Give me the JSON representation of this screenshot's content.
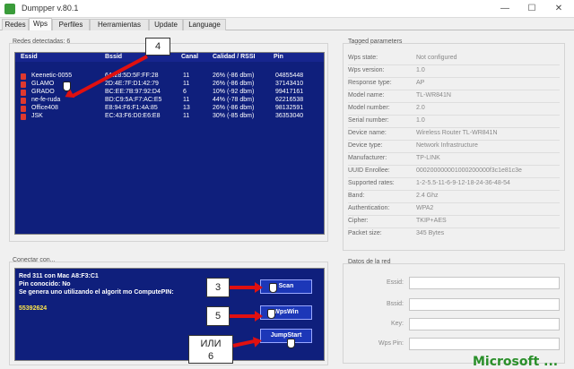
{
  "window": {
    "title": "Dumpper v.80.1",
    "min_glyph": "—",
    "max_glyph": "☐",
    "close_glyph": "✕"
  },
  "tabs": [
    {
      "label": "Redes"
    },
    {
      "label": "Wps"
    },
    {
      "label": "Perfiles"
    },
    {
      "label": "Herramientas"
    },
    {
      "label": "Update"
    },
    {
      "label": "Language"
    }
  ],
  "networks": {
    "group_label": "Redes detectadas: 6",
    "columns": [
      "Essid",
      "Bssid",
      "Canal",
      "Calidad / RSSI",
      "Pin"
    ],
    "rows": [
      {
        "essid": "Keenetic-0055",
        "bssid": "6A:28:5D:5F:FF:28",
        "canal": "11",
        "calidad": "26% (-86 dbm)",
        "pin": "04855448"
      },
      {
        "essid": "GLAMO",
        "bssid": "2D:4E:7F:D1:42:79",
        "canal": "11",
        "calidad": "26% (-86 dbm)",
        "pin": "37143410"
      },
      {
        "essid": "GRADO",
        "bssid": "BC:EE:7B:97:92:D4",
        "canal": "6",
        "calidad": "10% (-92 dbm)",
        "pin": "99417161"
      },
      {
        "essid": "ne-fe-ruda",
        "bssid": "BD:C9:5A:F7:AC:E5",
        "canal": "11",
        "calidad": "44% (-78 dbm)",
        "pin": "62216538"
      },
      {
        "essid": "Office408",
        "bssid": "E8:94:F6:F1:4A:85",
        "canal": "13",
        "calidad": "26% (-86 dbm)",
        "pin": "98132591"
      },
      {
        "essid": "JSK",
        "bssid": "EC:43:F6:D0:E6:E8",
        "canal": "11",
        "calidad": "30% (-85 dbm)",
        "pin": "36353040"
      }
    ]
  },
  "tagged": {
    "group_label": "Tagged parameters",
    "items": [
      {
        "label": "Wps state:",
        "value": "Not configured"
      },
      {
        "label": "Wps version:",
        "value": "1.0"
      },
      {
        "label": "Response type:",
        "value": "AP"
      },
      {
        "label": "Model name:",
        "value": "TL-WR841N"
      },
      {
        "label": "Model number:",
        "value": "2.0"
      },
      {
        "label": "Serial number:",
        "value": "1.0"
      },
      {
        "label": "Device name:",
        "value": "Wireless Router TL-WR841N"
      },
      {
        "label": "Device type:",
        "value": "Network Infrastructure"
      },
      {
        "label": "Manufacturer:",
        "value": "TP-LINK"
      },
      {
        "label": "UUID Enrollee:",
        "value": "000200000001000200000f3c1e81c3e"
      },
      {
        "label": "Supported rates:",
        "value": "1-2-5.5-11-6-9-12-18-24-36-48-54"
      },
      {
        "label": "Band:",
        "value": "2.4 Ghz"
      },
      {
        "label": "Authentication:",
        "value": "WPA2"
      },
      {
        "label": "Cipher:",
        "value": "TKIP+AES"
      },
      {
        "label": "Packet size:",
        "value": "345 Bytes"
      }
    ]
  },
  "connect": {
    "group_label": "Conectar con...",
    "lines": [
      "Red 311 con Mac A8:F3:C1",
      "Pin conocido: No",
      "Se genera uno utilizando el algorit mo ComputePIN:",
      "55392624"
    ],
    "scan_label": "Scan",
    "wpswin_label": "WpsWin",
    "jumpstart_label": "JumpStart"
  },
  "datos": {
    "group_label": "Datos de la red",
    "fields": [
      {
        "label": "Essid:"
      },
      {
        "label": "Bssid:"
      },
      {
        "label": "Key:"
      },
      {
        "label": "Wps Pin:"
      }
    ]
  },
  "callouts": {
    "c4": "4",
    "c3": "3",
    "c5": "5",
    "c6a": "ИЛИ",
    "c6b": "6"
  },
  "watermark": "Microsoft ..."
}
